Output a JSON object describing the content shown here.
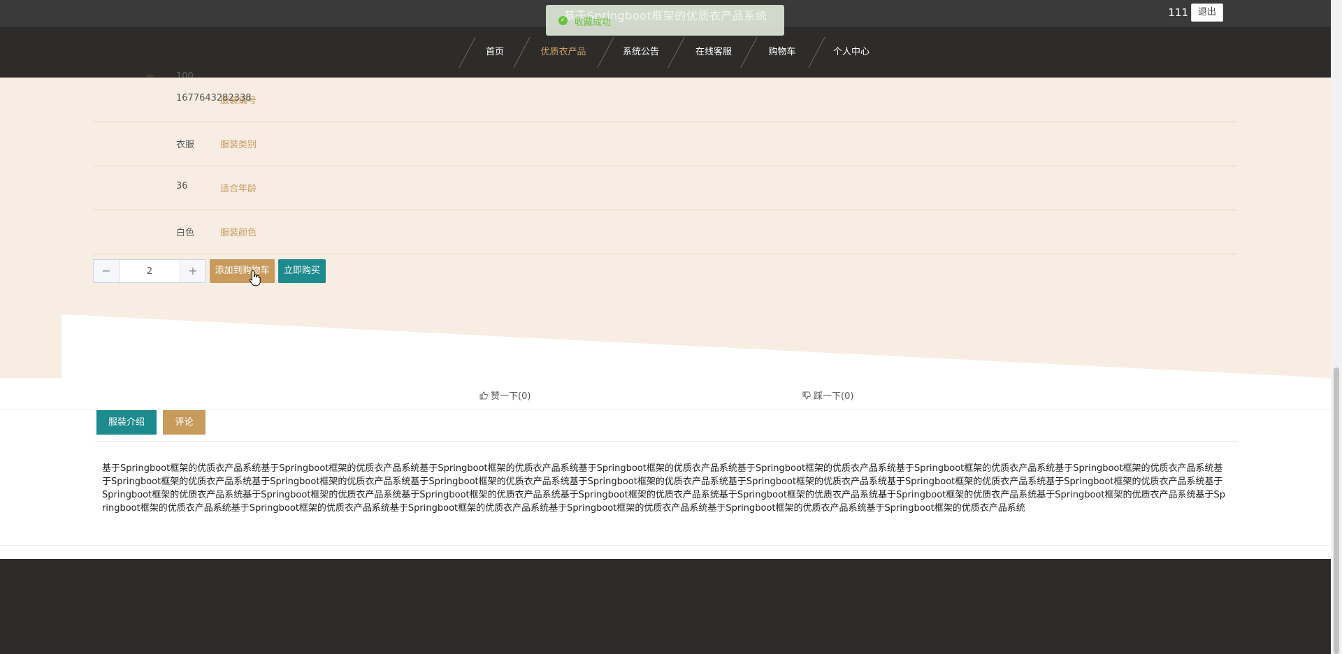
{
  "header": {
    "site_title": "基于Springboot框架的优质衣产品系统",
    "username": "111",
    "logout_label": "退出"
  },
  "nav": {
    "items": [
      {
        "label": "首页"
      },
      {
        "label": "优质衣产品",
        "active": true
      },
      {
        "label": "系统公告"
      },
      {
        "label": "在线客服"
      },
      {
        "label": "购物车"
      },
      {
        "label": "个人中心"
      }
    ]
  },
  "toast": {
    "message": "收藏成功",
    "icon": "success-check-icon"
  },
  "detail": {
    "stock_label": "库存",
    "stock_value": "100",
    "fields": [
      {
        "label": "服装编号",
        "value": "1677643282338"
      },
      {
        "label": "服装类别",
        "value": "衣服"
      },
      {
        "label": "适合年龄",
        "value": "36"
      },
      {
        "label": "服装颜色",
        "value": "白色"
      }
    ]
  },
  "purchase": {
    "quantity": "2",
    "minus_symbol": "−",
    "plus_symbol": "+",
    "add_to_cart_label": "添加到购物车",
    "buy_now_label": "立即购买"
  },
  "votes": {
    "like_label": "赞一下(0)",
    "dislike_label": "踩一下(0)"
  },
  "tabs": {
    "intro_label": "服装介绍",
    "comments_label": "评论"
  },
  "description": "基于Springboot框架的优质衣产品系统基于Springboot框架的优质衣产品系统基于Springboot框架的优质衣产品系统基于Springboot框架的优质衣产品系统基于Springboot框架的优质衣产品系统基于Springboot框架的优质衣产品系统基于Springboot框架的优质衣产品系统基于Springboot框架的优质衣产品系统基于Springboot框架的优质衣产品系统基于Springboot框架的优质衣产品系统基于Springboot框架的优质衣产品系统基于Springboot框架的优质衣产品系统基于Springboot框架的优质衣产品系统基于Springboot框架的优质衣产品系统基于Springboot框架的优质衣产品系统基于Springboot框架的优质衣产品系统基于Springboot框架的优质衣产品系统基于Springboot框架的优质衣产品系统基于Springboot框架的优质衣产品系统基于Springboot框架的优质衣产品系统基于Springboot框架的优质衣产品系统基于Springboot框架的优质衣产品系统基于Springboot框架的优质衣产品系统基于Springboot框架的优质衣产品系统基于Springboot框架的优质衣产品系统基于Springboot框架的优质衣产品系统基于Springboot框架的优质衣产品系统",
  "colors": {
    "accent_gold": "#c89b5c",
    "accent_teal": "#1d8a8e",
    "panel_bg": "#f8ede3",
    "nav_bg": "#2e2c2b"
  }
}
